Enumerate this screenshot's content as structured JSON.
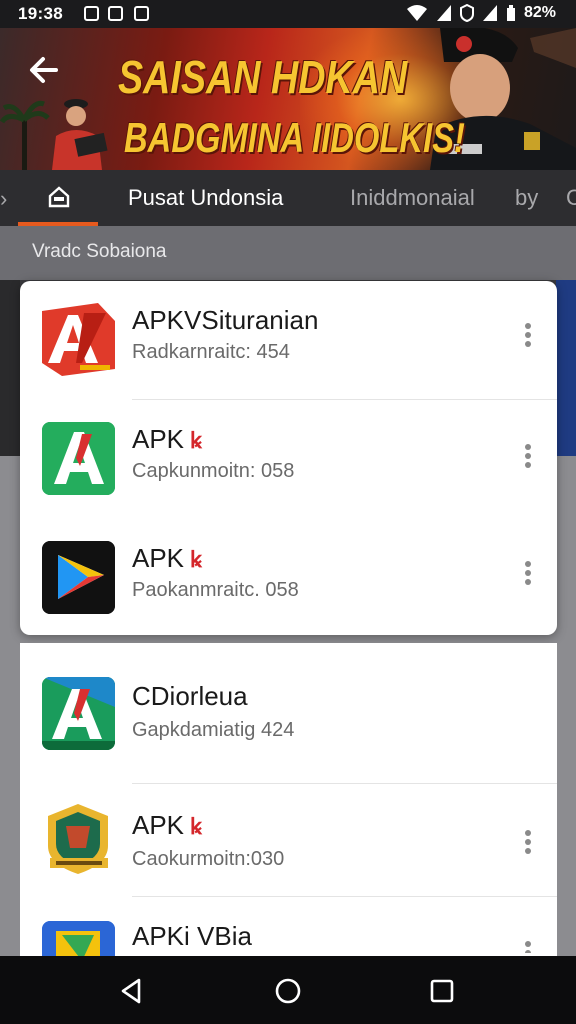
{
  "status": {
    "time": "19:38",
    "battery": "82%"
  },
  "banner": {
    "title": "SAISAN HDKAN",
    "subtitle": "BADGMINA IIDOLKIS!"
  },
  "tabs": [
    {
      "label": "",
      "icon": "home-icon",
      "active": true
    },
    {
      "label": "Pusat Undonsia",
      "active": false
    },
    {
      "label": "Iniddmonaial",
      "active": false
    },
    {
      "label": "by",
      "active": false
    },
    {
      "label": "C",
      "active": false
    }
  ],
  "section": {
    "title": "Vradc Sobaiona"
  },
  "apps": [
    {
      "title": "APKVSituranian",
      "badge": "",
      "subtitle": "Radkarnraitc: 454",
      "icon": "red-a-logo-icon",
      "menu": true
    },
    {
      "title": "APK",
      "badge": "ꝃ",
      "subtitle": "Capkunmoitn: 058",
      "icon": "green-a-logo-icon",
      "menu": true
    },
    {
      "title": "APK",
      "badge": "ꝃ",
      "subtitle": "Paokanmraitc. 058",
      "icon": "play-triangle-icon",
      "menu": true
    },
    {
      "title": "CDiorleua",
      "badge": "",
      "subtitle": "Gapkdamiatig 424",
      "icon": "teal-a-logo-icon",
      "menu": false
    },
    {
      "title": "APK",
      "badge": "ꝃ",
      "subtitle": "Caokurmoitn:030",
      "icon": "shield-emblem-icon",
      "menu": true
    },
    {
      "title": "APKi VBia",
      "badge": "",
      "subtitle": "",
      "icon": "blue-folder-icon",
      "menu": true
    }
  ],
  "colors": {
    "accent": "#e65a1e",
    "banner_text": "#f6c531",
    "badge": "#d4262b"
  }
}
